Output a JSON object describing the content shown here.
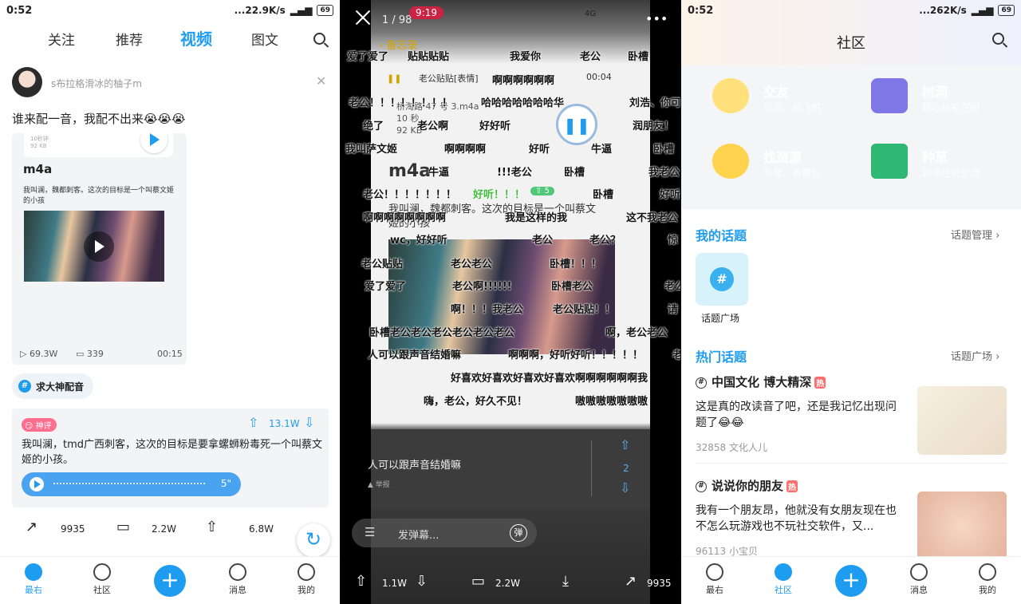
{
  "left": {
    "status": {
      "time": "0:52",
      "speed": "...22.9K/s",
      "battery": "69"
    },
    "nav": {
      "follow": "关注",
      "recommend": "推荐",
      "video": "视频",
      "image_text": "图文"
    },
    "post": {
      "username": "s布拉格滑冰的柚子m",
      "text": "谁来配一音，我配不出来😭😭😭",
      "audio_title": "m4a",
      "audio_meta1": "10秒钟",
      "audio_meta2": "92 KB",
      "desc": "我叫澜，魏都刺客。这次的目标是一个叫蔡文姬的小孩",
      "plays": "69.3W",
      "danmaku_count": "339",
      "duration": "00:15"
    },
    "tag": "求大神配音",
    "god_comment": {
      "badge": "神评",
      "likes": "13.1W",
      "text": "我叫澜，tmd广西刺客，这次的目标是要拿螺蛳粉毒死一个叫蔡文姬的小孩。",
      "voice_duration": "5\""
    },
    "actions": {
      "share": "9935",
      "comments": "2.2W",
      "likes": "6.8W"
    },
    "bottom": {
      "latest": "最右",
      "community": "社区",
      "messages": "消息",
      "mine": "我的"
    }
  },
  "middle": {
    "counter": "1 / 98",
    "inner_status": {
      "time": "9:19",
      "network": "4G"
    },
    "inner_nav_back": "备忘录",
    "audio_file": "老公贴贴[表情]",
    "audio_time": "00:04",
    "file_name": "桥淘路 47 号 3.m4a",
    "file_meta1": "10 秒",
    "file_meta2": "92 KB",
    "title": "m4a",
    "danmaku": [
      "爱了爱了",
      "贴贴贴贴",
      "我爱你",
      "老公",
      "卧槽",
      "啊啊啊啊啊啊",
      "老公！！！！！！！！",
      "哈哈哈哈哈哈哈华",
      "刘浩、你可爱",
      "绝了",
      "老公啊",
      "好好听",
      "润朋友！",
      "我叫萨文姬",
      "啊啊啊啊",
      "好听",
      "牛逼",
      "卧槽",
      "牛逼",
      "!!!老公",
      "卧槽",
      "我老公",
      "老公！！！！！！！",
      "好听！！！",
      "卧槽",
      "好听",
      "啊啊啊啊啊啊啊啊",
      "我是这样的我",
      "这不我老公",
      "wc，好好听",
      "老公",
      "老公？",
      "惊",
      "老公贴贴",
      "老公老公",
      "卧槽！！！",
      "爱了爱了",
      "老公啊!!!!!!",
      "卧槽老公",
      "老公",
      "啊！！！我老公",
      "老公贴贴！！",
      "请",
      "卧槽老公老公老公老公老公老公",
      "啊，老公老公",
      "人可以跟声音结婚嘛",
      "啊啊啊，好听好听！！！！！",
      "老",
      "好喜欢好喜欢好喜欢好喜欢啊啊啊啊啊啊我",
      "嗨，老公，好久不见！",
      "嗷嗷嗷嗷嗷嗷嗷"
    ],
    "green_count": "5",
    "desc_line1": "我叫澜，魏都刺客。这次的目标是一个叫蔡文",
    "desc_line2": "姬的小孩",
    "dialog": {
      "text": "人可以跟声音结婚嘛",
      "report": "举报",
      "votes": "2"
    },
    "danmaku_input": "发弹幕...",
    "danmaku_toggle": "弹",
    "actions": {
      "up": "1.1W",
      "comments": "2.2W",
      "share": "9935"
    }
  },
  "right": {
    "status": {
      "time": "0:52",
      "speed": "...262K/s",
      "battery": "69"
    },
    "title": "社区",
    "tiles": [
      {
        "title": "交友",
        "sub": "动态、纸飞机",
        "color": "#f77b96"
      },
      {
        "title": "树洞",
        "sub": "暖心秘密空间",
        "color": "#a79af0"
      },
      {
        "title": "找资源",
        "sub": "头像、表情包",
        "color": "#69b8ee"
      },
      {
        "title": "种草",
        "sub": "剁手经验交流",
        "color": "#4fd3a3"
      }
    ],
    "my_topics": {
      "title": "我的话题",
      "manage": "话题管理",
      "square": "话题广场"
    },
    "hot_topics": {
      "title": "热门话题",
      "link": "话题广场"
    },
    "hot_badge": "热",
    "topics": [
      {
        "name": "中国文化 博大精深",
        "text": "这是真的改读音了吧，还是我记忆出现问题了😂😂",
        "meta": "32858 文化人儿"
      },
      {
        "name": "说说你的朋友",
        "text": "我有一个朋友昂，他就没有女朋友现在也不怎么玩游戏也不玩社交软件，又...",
        "meta": "96113 小宝贝"
      }
    ],
    "bottom": {
      "latest": "最右",
      "community": "社区",
      "messages": "消息",
      "mine": "我的"
    }
  }
}
